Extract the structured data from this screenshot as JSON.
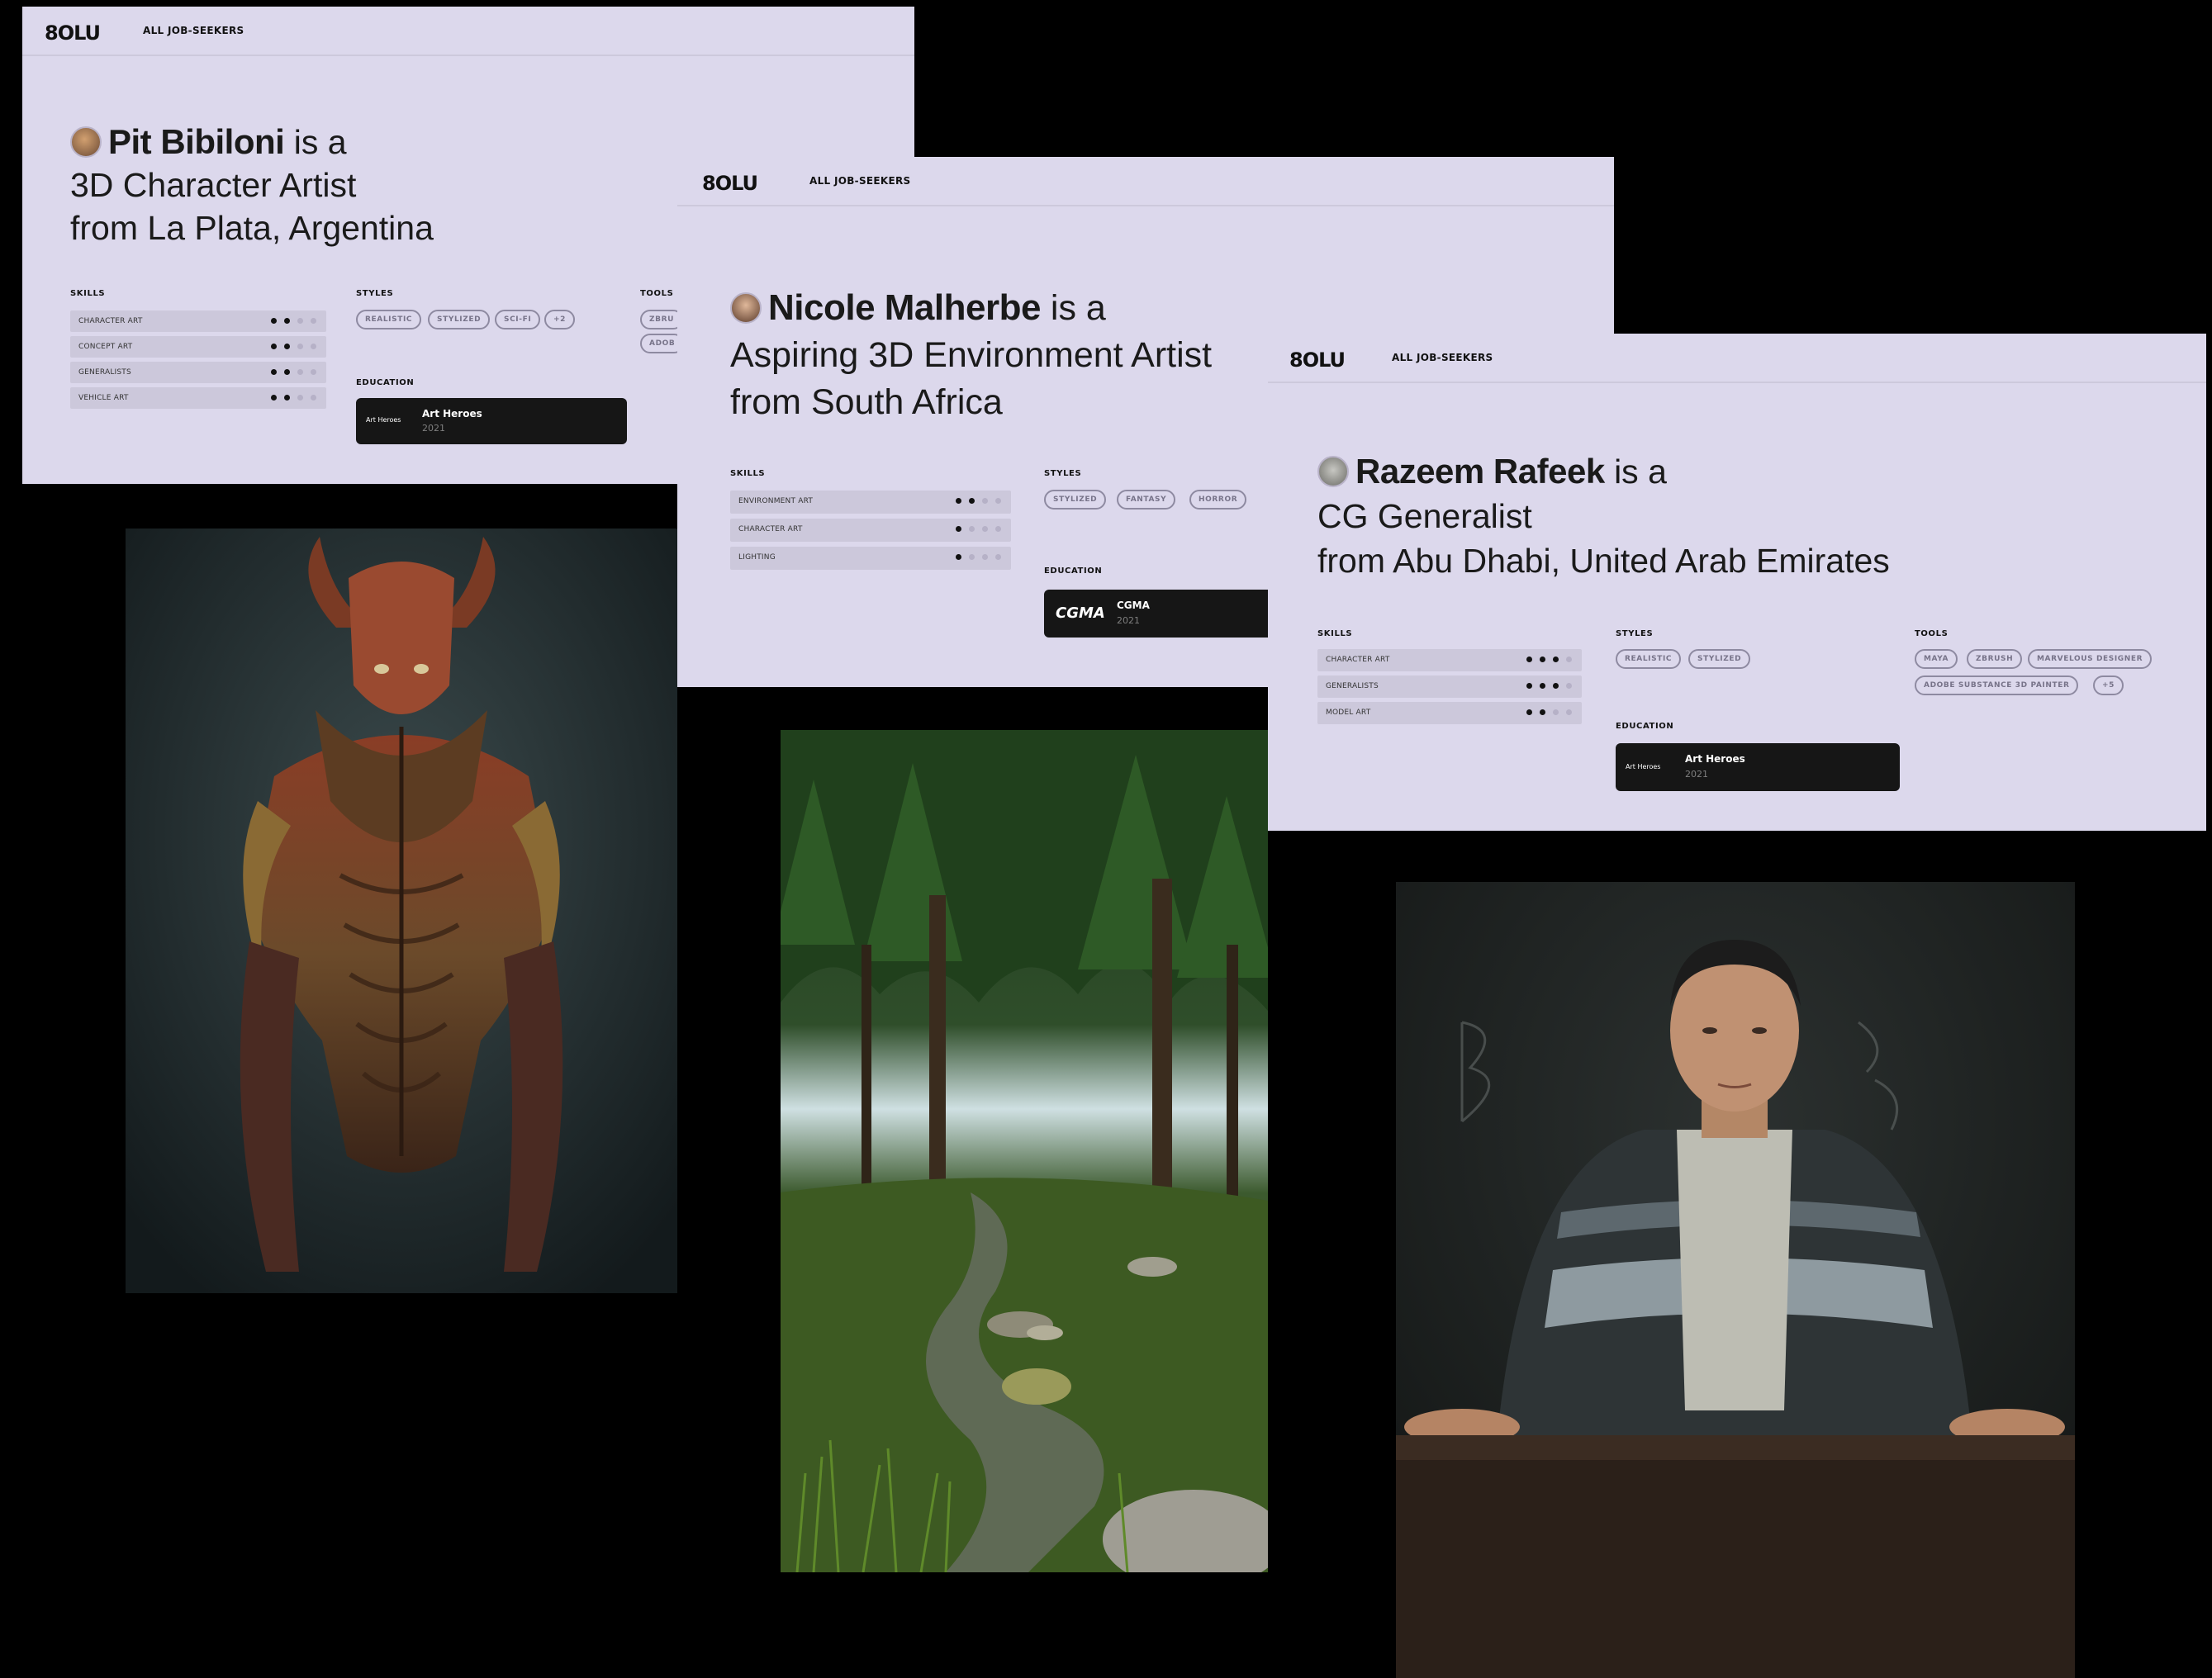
{
  "brand": "8OLU",
  "nav_link": "ALL JOB-SEEKERS",
  "section_labels": {
    "skills": "SKILLS",
    "styles": "STYLES",
    "tools": "TOOLS",
    "education": "EDUCATION"
  },
  "profiles": [
    {
      "name": "Pit Bibiloni",
      "is_a": " is a",
      "role": "3D Character Artist",
      "location": "from La Plata, Argentina",
      "skills": [
        {
          "label": "CHARACTER ART",
          "level": 2
        },
        {
          "label": "CONCEPT ART",
          "level": 2
        },
        {
          "label": "GENERALISTS",
          "level": 2
        },
        {
          "label": "VEHICLE ART",
          "level": 2
        }
      ],
      "styles": [
        "REALISTIC",
        "STYLIZED",
        "SCI-FI",
        "+2"
      ],
      "tools": [
        "ZBRU",
        "ADOB"
      ],
      "education": {
        "school": "Art Heroes",
        "year": "2021",
        "logo_text": "Art Heroes"
      }
    },
    {
      "name": "Nicole Malherbe",
      "is_a": " is a",
      "role": "Aspiring 3D Environment Artist",
      "location": "from South Africa",
      "skills": [
        {
          "label": "ENVIRONMENT ART",
          "level": 2
        },
        {
          "label": "CHARACTER ART",
          "level": 1
        },
        {
          "label": "LIGHTING",
          "level": 1
        }
      ],
      "styles": [
        "STYLIZED",
        "FANTASY",
        "HORROR"
      ],
      "education": {
        "school": "CGMA",
        "year": "2021",
        "logo_text": "CGMA"
      }
    },
    {
      "name": "Razeem Rafeek",
      "is_a": " is a",
      "role": "CG Generalist",
      "location": "from Abu Dhabi, United Arab Emirates",
      "skills": [
        {
          "label": "CHARACTER ART",
          "level": 3
        },
        {
          "label": "GENERALISTS",
          "level": 3
        },
        {
          "label": "MODEL ART",
          "level": 2
        }
      ],
      "styles": [
        "REALISTIC",
        "STYLIZED"
      ],
      "tools": [
        "MAYA",
        "ZBRUSH",
        "MARVELOUS DESIGNER",
        "ADOBE SUBSTANCE 3D PAINTER",
        "+5"
      ],
      "education": {
        "school": "Art Heroes",
        "year": "2021",
        "logo_text": "Art Heroes"
      }
    }
  ],
  "artworks": [
    {
      "subject": "creature-artwork"
    },
    {
      "subject": "forest-stream-artwork"
    },
    {
      "subject": "portrait-artwork"
    }
  ]
}
